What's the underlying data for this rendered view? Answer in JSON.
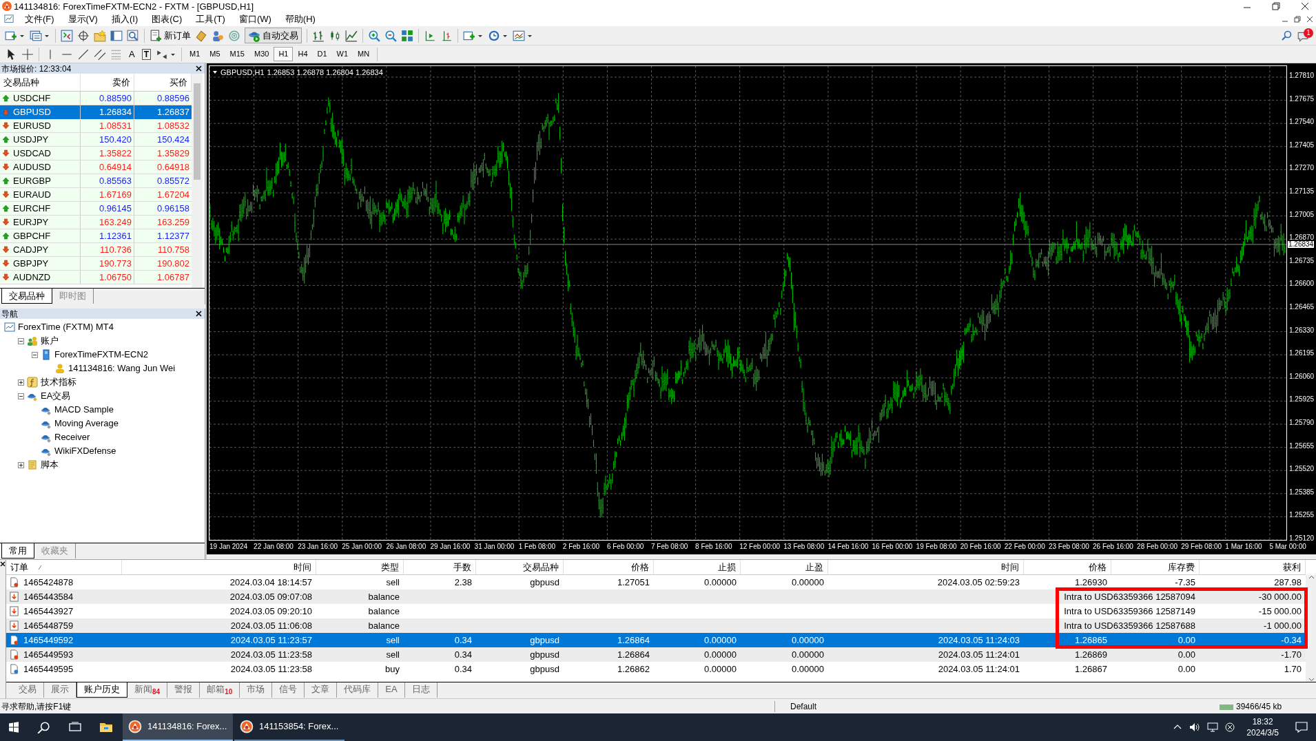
{
  "window": {
    "title": "141134816: ForexTimeFXTM-ECN2 - FXTM - [GBPUSD,H1]"
  },
  "menu": [
    "文件(F)",
    "显示(V)",
    "插入(I)",
    "图表(C)",
    "工具(T)",
    "窗口(W)",
    "帮助(H)"
  ],
  "toolbar": {
    "new_order": "新订单",
    "auto_trading": "自动交易",
    "text_tool": "A",
    "label_tool": "T",
    "alert_badge": "1",
    "timeframes": [
      {
        "label": "M1",
        "selected": false
      },
      {
        "label": "M5",
        "selected": false
      },
      {
        "label": "M15",
        "selected": false
      },
      {
        "label": "M30",
        "selected": false
      },
      {
        "label": "H1",
        "selected": true
      },
      {
        "label": "H4",
        "selected": false
      },
      {
        "label": "D1",
        "selected": false
      },
      {
        "label": "W1",
        "selected": false
      },
      {
        "label": "MN",
        "selected": false
      }
    ]
  },
  "market_watch": {
    "title": "市场报价: 12:33:04",
    "columns": [
      "交易品种",
      "卖价",
      "买价"
    ],
    "rows": [
      {
        "symbol": "USDCHF",
        "bid": "0.88590",
        "ask": "0.88596",
        "rising": true,
        "selected": false
      },
      {
        "symbol": "GBPUSD",
        "bid": "1.26834",
        "ask": "1.26837",
        "rising": false,
        "selected": true
      },
      {
        "symbol": "EURUSD",
        "bid": "1.08531",
        "ask": "1.08532",
        "rising": false,
        "selected": false
      },
      {
        "symbol": "USDJPY",
        "bid": "150.420",
        "ask": "150.424",
        "rising": true,
        "selected": false
      },
      {
        "symbol": "USDCAD",
        "bid": "1.35822",
        "ask": "1.35829",
        "rising": false,
        "selected": false
      },
      {
        "symbol": "AUDUSD",
        "bid": "0.64914",
        "ask": "0.64918",
        "rising": false,
        "selected": false
      },
      {
        "symbol": "EURGBP",
        "bid": "0.85563",
        "ask": "0.85572",
        "rising": true,
        "selected": false
      },
      {
        "symbol": "EURAUD",
        "bid": "1.67169",
        "ask": "1.67204",
        "rising": false,
        "selected": false
      },
      {
        "symbol": "EURCHF",
        "bid": "0.96145",
        "ask": "0.96158",
        "rising": true,
        "selected": false
      },
      {
        "symbol": "EURJPY",
        "bid": "163.249",
        "ask": "163.259",
        "rising": false,
        "selected": false
      },
      {
        "symbol": "GBPCHF",
        "bid": "1.12361",
        "ask": "1.12377",
        "rising": true,
        "selected": false
      },
      {
        "symbol": "CADJPY",
        "bid": "110.736",
        "ask": "110.758",
        "rising": false,
        "selected": false
      },
      {
        "symbol": "GBPJPY",
        "bid": "190.773",
        "ask": "190.802",
        "rising": false,
        "selected": false
      },
      {
        "symbol": "AUDNZD",
        "bid": "1.06750",
        "ask": "1.06787",
        "rising": false,
        "selected": false
      }
    ],
    "tabs": [
      {
        "label": "交易品种",
        "selected": true
      },
      {
        "label": "即时图",
        "selected": false
      }
    ]
  },
  "navigator": {
    "title": "导航",
    "tree": [
      {
        "label": "ForexTime (FXTM) MT4",
        "kind": "terminal",
        "children": [
          {
            "label": "账户",
            "kind": "accounts",
            "expanded": true,
            "children": [
              {
                "label": "ForexTimeFXTM-ECN2",
                "kind": "server",
                "expanded": true,
                "children": [
                  {
                    "label": "141134816: Wang Jun Wei",
                    "kind": "user"
                  }
                ]
              }
            ]
          },
          {
            "label": "技术指标",
            "kind": "indicators",
            "expanded": false
          },
          {
            "label": "EA交易",
            "kind": "experts",
            "expanded": true,
            "children": [
              {
                "label": "MACD Sample",
                "kind": "expert"
              },
              {
                "label": "Moving Average",
                "kind": "expert"
              },
              {
                "label": "Receiver",
                "kind": "expert"
              },
              {
                "label": "WikiFXDefense",
                "kind": "expert"
              }
            ]
          },
          {
            "label": "脚本",
            "kind": "scripts",
            "expanded": false
          }
        ]
      }
    ],
    "tabs": [
      {
        "label": "常用",
        "selected": true
      },
      {
        "label": "收藏夹",
        "selected": false
      }
    ]
  },
  "chart": {
    "symbol": "GBPUSD,H1",
    "ohlc": "1.26853 1.26878 1.26804 1.26834",
    "current_price": "1.26834",
    "price_ticks": [
      "1.27810",
      "1.27675",
      "1.27540",
      "1.27405",
      "1.27270",
      "1.27135",
      "1.27005",
      "1.26870",
      "1.26735",
      "1.26600",
      "1.26465",
      "1.26330",
      "1.26195",
      "1.26060",
      "1.25925",
      "1.25790",
      "1.25655",
      "1.25520",
      "1.25385",
      "1.25255",
      "1.25120"
    ],
    "time_labels": [
      "19 Jan 2024",
      "22 Jan 08:00",
      "23 Jan 16:00",
      "25 Jan 00:00",
      "26 Jan 08:00",
      "29 Jan 16:00",
      "31 Jan 00:00",
      "1 Feb 08:00",
      "2 Feb 16:00",
      "6 Feb 00:00",
      "7 Feb 08:00",
      "8 Feb 16:00",
      "12 Feb 00:00",
      "13 Feb 08:00",
      "14 Feb 16:00",
      "16 Feb 00:00",
      "19 Feb 08:00",
      "20 Feb 16:00",
      "22 Feb 00:00",
      "23 Feb 08:00",
      "26 Feb 16:00",
      "28 Feb 00:00",
      "29 Feb 08:00",
      "1 Mar 16:00",
      "5 Mar 00:00"
    ]
  },
  "terminal": {
    "columns": [
      "订单",
      "时间",
      "类型",
      "手数",
      "交易品种",
      "价格",
      "止损",
      "止盈",
      "时间",
      "价格",
      "库存费",
      "获利"
    ],
    "rows": [
      {
        "kind": "sell",
        "order": "1465424878",
        "time": "2024.03.04 18:14:57",
        "type": "sell",
        "lots": "2.38",
        "symbol": "gbpusd",
        "price": "1.27051",
        "sl": "0.00000",
        "tp": "0.00000",
        "close_time": "2024.03.05 02:59:23",
        "close_price": "1.26930",
        "swap": "-7.35",
        "profit": "287.98",
        "selected": false
      },
      {
        "kind": "balance",
        "order": "1465443584",
        "time": "2024.03.05 09:07:08",
        "type": "balance",
        "comment": "Intra to USD63359366 12587094",
        "profit": "-30 000.00",
        "selected": false
      },
      {
        "kind": "balance",
        "order": "1465443927",
        "time": "2024.03.05 09:20:10",
        "type": "balance",
        "comment": "Intra to USD63359366 12587149",
        "profit": "-15 000.00",
        "selected": false
      },
      {
        "kind": "balance",
        "order": "1465448759",
        "time": "2024.03.05 11:06:08",
        "type": "balance",
        "comment": "Intra to USD63359366 12587688",
        "profit": "-1 000.00",
        "selected": false
      },
      {
        "kind": "sell",
        "order": "1465449592",
        "time": "2024.03.05 11:23:57",
        "type": "sell",
        "lots": "0.34",
        "symbol": "gbpusd",
        "price": "1.26864",
        "sl": "0.00000",
        "tp": "0.00000",
        "close_time": "2024.03.05 11:24:03",
        "close_price": "1.26865",
        "swap": "0.00",
        "profit": "-0.34",
        "selected": true
      },
      {
        "kind": "sell",
        "order": "1465449593",
        "time": "2024.03.05 11:23:58",
        "type": "sell",
        "lots": "0.34",
        "symbol": "gbpusd",
        "price": "1.26864",
        "sl": "0.00000",
        "tp": "0.00000",
        "close_time": "2024.03.05 11:24:01",
        "close_price": "1.26869",
        "swap": "0.00",
        "profit": "-1.70",
        "selected": false
      },
      {
        "kind": "buy",
        "order": "1465449595",
        "time": "2024.03.05 11:23:58",
        "type": "buy",
        "lots": "0.34",
        "symbol": "gbpusd",
        "price": "1.26862",
        "sl": "0.00000",
        "tp": "0.00000",
        "close_time": "2024.03.05 11:24:01",
        "close_price": "1.26867",
        "swap": "0.00",
        "profit": "1.70",
        "selected": false
      }
    ],
    "tabs": [
      {
        "label": "交易",
        "selected": false
      },
      {
        "label": "展示",
        "selected": false
      },
      {
        "label": "账户历史",
        "selected": true
      },
      {
        "label": "新闻",
        "badge": "84",
        "selected": false
      },
      {
        "label": "警报",
        "selected": false
      },
      {
        "label": "邮箱",
        "badge": "10",
        "selected": false
      },
      {
        "label": "市场",
        "selected": false
      },
      {
        "label": "信号",
        "selected": false
      },
      {
        "label": "文章",
        "selected": false
      },
      {
        "label": "代码库",
        "selected": false
      },
      {
        "label": "EA",
        "selected": false
      },
      {
        "label": "日志",
        "selected": false
      }
    ]
  },
  "status_bar": {
    "help": "寻求帮助,请按F1键",
    "profile": "Default",
    "traffic": "39466/45 kb"
  },
  "taskbar": {
    "apps": [
      {
        "label": "141134816: Forex...",
        "selected": true
      },
      {
        "label": "141153854: Forex...",
        "selected": false
      }
    ],
    "time": "18:32",
    "date": "2024/3/5"
  }
}
